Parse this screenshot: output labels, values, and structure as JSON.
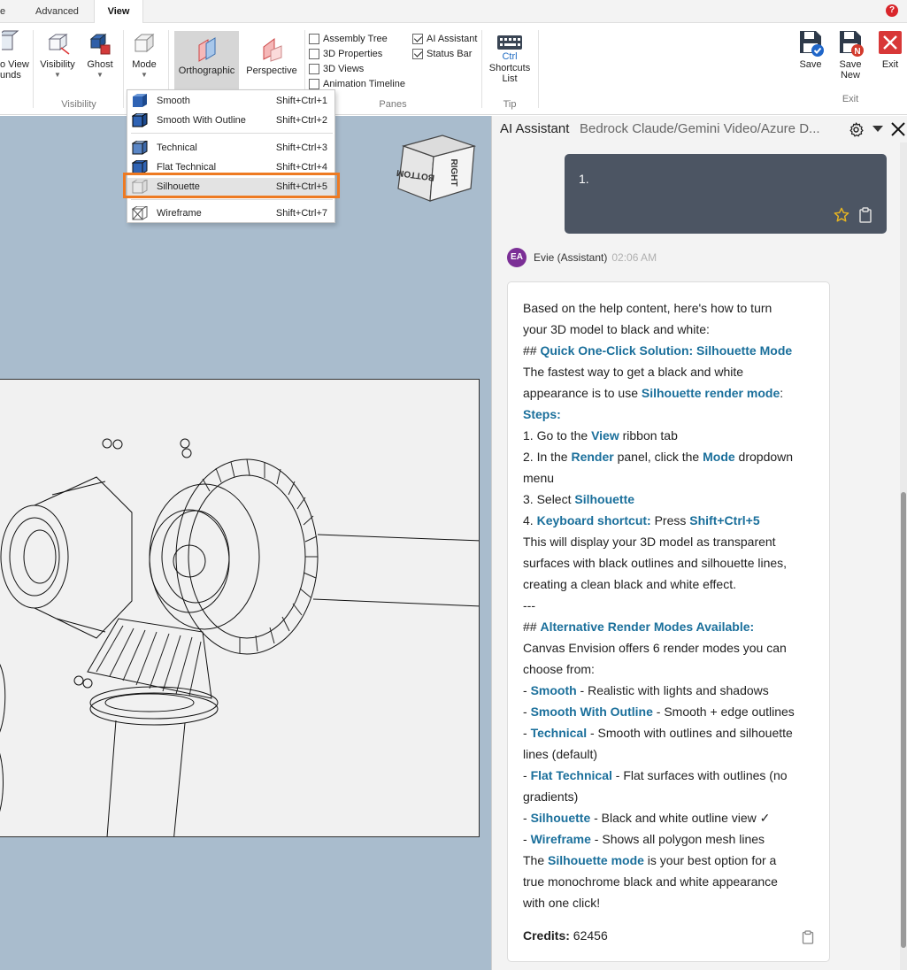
{
  "tabs": {
    "t1": "e",
    "advanced": "Advanced",
    "view": "View"
  },
  "ribbon": {
    "view_bounds": "o View\nunds",
    "visibility": "Visibility",
    "ghost": "Ghost",
    "mode": "Mode",
    "orthographic": "Orthographic",
    "perspective": "Perspective",
    "group_visibility": "Visibility",
    "checks": [
      {
        "label": "Assembly Tree",
        "checked": false
      },
      {
        "label": "3D Properties",
        "checked": false
      },
      {
        "label": "3D Views",
        "checked": false
      },
      {
        "label": "Animation Timeline",
        "checked": false
      },
      {
        "label": "AI Assistant",
        "checked": true
      },
      {
        "label": "Status Bar",
        "checked": true
      }
    ],
    "group_panes": "Panes",
    "ctrl_key": "Ctrl",
    "shortcuts_list": "Shortcuts\nList",
    "group_tip": "Tip",
    "save": "Save",
    "save_new": "Save\nNew",
    "exit": "Exit",
    "group_exit": "Exit"
  },
  "viewcube": {
    "face_front": "BOTTOM",
    "face_side": "RIGHT"
  },
  "mode_menu": [
    {
      "label": "Smooth",
      "shortcut": "Shift+Ctrl+1"
    },
    {
      "label": "Smooth With Outline",
      "shortcut": "Shift+Ctrl+2"
    },
    {
      "label": "Technical",
      "shortcut": "Shift+Ctrl+3"
    },
    {
      "label": "Flat Technical",
      "shortcut": "Shift+Ctrl+4"
    },
    {
      "label": "Silhouette",
      "shortcut": "Shift+Ctrl+5"
    },
    {
      "label": "Wireframe",
      "shortcut": "Shift+Ctrl+7"
    }
  ],
  "panel": {
    "title": "AI Assistant",
    "subtitle": "Bedrock Claude/Gemini Video/Azure D...",
    "user_message": "1.",
    "avatar_initials": "EA",
    "sender": "Evie (Assistant)",
    "time": "02:06 AM",
    "credits_label": "Credits:",
    "credits_value": "62456"
  },
  "reply_lines": [
    [
      {
        "t": "Based on the help content, here's how to turn"
      }
    ],
    [
      {
        "t": "your 3D model to black and white:"
      }
    ],
    [
      {
        "t": "## "
      },
      {
        "t": "Quick One-Click Solution: Silhouette Mode",
        "h": true
      }
    ],
    [
      {
        "t": "The fastest way to get a black and white"
      }
    ],
    [
      {
        "t": "appearance is to use "
      },
      {
        "t": "Silhouette render mode",
        "h": true
      },
      {
        "t": ":"
      }
    ],
    [
      {
        "t": "Steps:",
        "h": true
      }
    ],
    [
      {
        "t": "1. Go to the "
      },
      {
        "t": "View",
        "h": true
      },
      {
        "t": " ribbon tab"
      }
    ],
    [
      {
        "t": "2. In the "
      },
      {
        "t": "Render",
        "h": true
      },
      {
        "t": " panel, click the "
      },
      {
        "t": "Mode",
        "h": true
      },
      {
        "t": " dropdown"
      }
    ],
    [
      {
        "t": "menu"
      }
    ],
    [
      {
        "t": "3. Select "
      },
      {
        "t": "Silhouette",
        "h": true
      }
    ],
    [
      {
        "t": "4. "
      },
      {
        "t": "Keyboard shortcut:",
        "h": true
      },
      {
        "t": " Press "
      },
      {
        "t": "Shift+Ctrl+5",
        "h": true
      }
    ],
    [
      {
        "t": "This will display your 3D model as transparent"
      }
    ],
    [
      {
        "t": "surfaces with black outlines and silhouette lines,"
      }
    ],
    [
      {
        "t": "creating a clean black and white effect."
      }
    ],
    [
      {
        "t": "---"
      }
    ],
    [
      {
        "t": "## "
      },
      {
        "t": "Alternative Render Modes Available:",
        "h": true
      }
    ],
    [
      {
        "t": "Canvas Envision offers 6 render modes you can"
      }
    ],
    [
      {
        "t": "choose from:"
      }
    ],
    [
      {
        "t": "- "
      },
      {
        "t": "Smooth",
        "h": true
      },
      {
        "t": " - Realistic with lights and shadows"
      }
    ],
    [
      {
        "t": "- "
      },
      {
        "t": "Smooth With Outline",
        "h": true
      },
      {
        "t": " - Smooth + edge outlines"
      }
    ],
    [
      {
        "t": "- "
      },
      {
        "t": "Technical",
        "h": true
      },
      {
        "t": " - Smooth with outlines and silhouette"
      }
    ],
    [
      {
        "t": "lines (default)"
      }
    ],
    [
      {
        "t": "- "
      },
      {
        "t": "Flat Technical",
        "h": true
      },
      {
        "t": " - Flat surfaces with outlines (no"
      }
    ],
    [
      {
        "t": "gradients)"
      }
    ],
    [
      {
        "t": "- "
      },
      {
        "t": "Silhouette",
        "h": true
      },
      {
        "t": " - Black and white outline view ✓"
      }
    ],
    [
      {
        "t": "- "
      },
      {
        "t": "Wireframe",
        "h": true
      },
      {
        "t": " - Shows all polygon mesh lines"
      }
    ],
    [
      {
        "t": "The "
      },
      {
        "t": "Silhouette mode",
        "h": true
      },
      {
        "t": " is your best option for a"
      }
    ],
    [
      {
        "t": "true monochrome black and white appearance"
      }
    ],
    [
      {
        "t": "with one click!"
      }
    ]
  ],
  "colors": {
    "accent": "#1a6f9b",
    "highlight": "#ee7a22",
    "viewport": "#a9bccd",
    "user_bubble": "#4c5563",
    "avatar": "#7b2f96"
  }
}
